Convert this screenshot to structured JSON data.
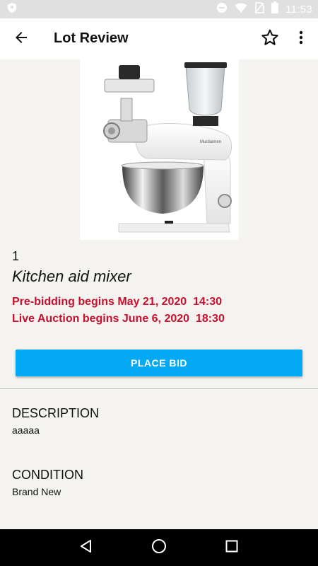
{
  "status_bar": {
    "time": "11:53",
    "icons": [
      "shield-icon",
      "do-not-disturb-icon",
      "wifi-icon",
      "no-sim-icon",
      "battery-icon"
    ]
  },
  "app_bar": {
    "title": "Lot Review",
    "icons": [
      "back-arrow-icon",
      "star-outline-icon",
      "more-vert-icon"
    ]
  },
  "lot": {
    "image_subject": "stand mixer with blender and meat grinder",
    "image_brand_text": "Murdaimen",
    "number": "1",
    "title": "Kitchen aid mixer",
    "pre_bidding": "Pre-bidding begins May 21, 2020  14:30",
    "live_auction": "Live Auction begins June 6, 2020  18:30"
  },
  "actions": {
    "place_bid_label": "PLACE BID"
  },
  "details": {
    "description_heading": "DESCRIPTION",
    "description_value": "aaaaa",
    "condition_heading": "CONDITION",
    "condition_value": "Brand New"
  },
  "nav_bar": {
    "icons": [
      "back-triangle-icon",
      "home-circle-icon",
      "recents-square-icon"
    ]
  },
  "colors": {
    "accent": "#03a9f4",
    "alert_red": "#c8102e",
    "app_bar": "#ffffff",
    "background": "#f4f3f0",
    "status_bar": "#e0e0e0",
    "nav_bar": "#000000"
  }
}
